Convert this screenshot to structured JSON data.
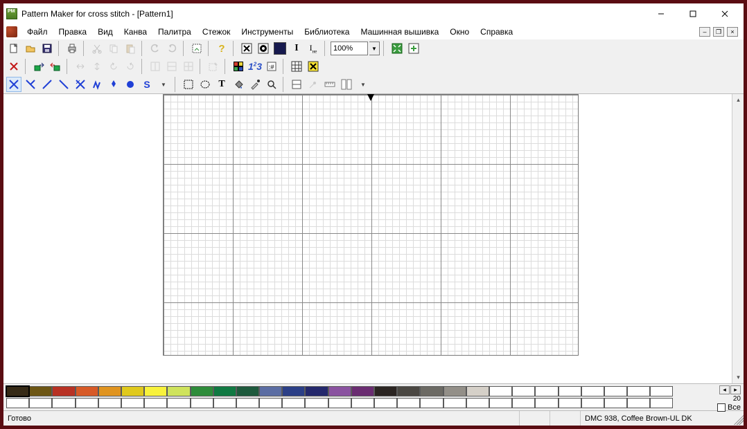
{
  "titlebar": {
    "title": "Pattern Maker for cross stitch - [Pattern1]"
  },
  "menubar": {
    "items": [
      "Файл",
      "Правка",
      "Вид",
      "Канва",
      "Палитра",
      "Стежок",
      "Инструменты",
      "Библиотека",
      "Машинная вышивка",
      "Окно",
      "Справка"
    ]
  },
  "toolbar1": {
    "zoom_value": "100%",
    "foreground_color": "#16194e"
  },
  "palette": {
    "row1": [
      "#362a16",
      "#6d5614",
      "#b83224",
      "#d75a27",
      "#e09420",
      "#e0c91d",
      "#f8f23c",
      "#cfe35c",
      "#2e8c3a",
      "#107942",
      "#1e5a3d",
      "#5b6da3",
      "#2b3f87",
      "#24286c",
      "#8a52a0",
      "#6a2c71",
      "#2b2522",
      "#4a4742",
      "#6c6a64",
      "#938f88",
      "#d5d0c8",
      "#ffffff",
      "#ffffff",
      "#ffffff",
      "#ffffff",
      "#ffffff",
      "#ffffff",
      "#ffffff",
      "#ffffff"
    ],
    "row2_empty_count": 29,
    "selected_index": 0,
    "count_label": "20",
    "checkbox_label": "Все"
  },
  "statusbar": {
    "ready": "Готово",
    "color_info": "DMC  938, Coffee Brown-UL DK"
  }
}
